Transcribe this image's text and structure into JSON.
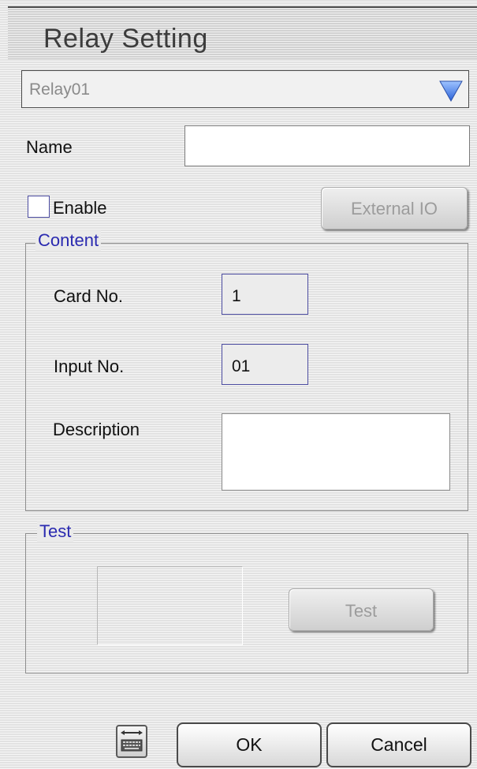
{
  "dialog": {
    "title": "Relay Setting"
  },
  "relay_select": {
    "value": "Relay01"
  },
  "name_field": {
    "label": "Name",
    "value": ""
  },
  "enable": {
    "label": "Enable",
    "checked": false
  },
  "external_io": {
    "label": "External IO"
  },
  "content": {
    "legend": "Content",
    "card_no_label": "Card No.",
    "card_no_value": "1",
    "input_no_label": "Input No.",
    "input_no_value": "01",
    "description_label": "Description",
    "description_value": ""
  },
  "test": {
    "legend": "Test",
    "button_label": "Test"
  },
  "footer": {
    "ok_label": "OK",
    "cancel_label": "Cancel",
    "keyboard_icon": "keyboard-icon"
  },
  "colors": {
    "legend": "#2a2ab0",
    "dropdown_arrow": "#3f7be8",
    "checkbox_border": "#4b4ba0"
  }
}
